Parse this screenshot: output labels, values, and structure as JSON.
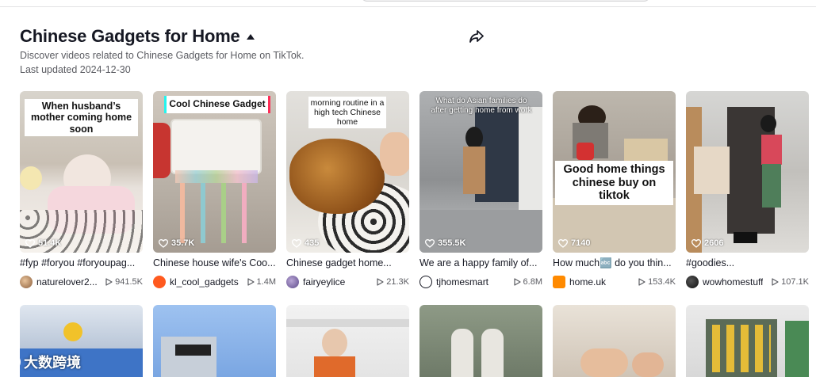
{
  "header": {
    "title": "Chinese Gadgets for Home",
    "description": "Discover videos related to Chinese Gadgets for Home on TikTok.",
    "last_updated": "Last updated 2024-12-30"
  },
  "videos": [
    {
      "overlay": "When husband’s mother coming home soon",
      "views": "51.4K",
      "caption": "#fyp #foryou #foryoupag...",
      "author": "naturelover2...",
      "plays": "941.5K"
    },
    {
      "overlay": "Cool Chinese Gadget",
      "views": "35.7K",
      "caption": "Chinese house wife's Coo...",
      "author": "kl_cool_gadgets",
      "plays": "1.4M"
    },
    {
      "overlay": "morning routine in a high tech Chinese home",
      "views": "435",
      "caption": "Chinese gadget home...",
      "author": "fairyeylice",
      "plays": "21.3K"
    },
    {
      "overlay": "What do Asian families do after getting home from work",
      "views": "355.5K",
      "caption": "We are a happy family of...",
      "author": "tjhomesmart",
      "plays": "6.8M"
    },
    {
      "overlay": "Good home things chinese buy on tiktok",
      "views": "7140",
      "caption": "How much🔤 do you thin...",
      "author": "home.uk",
      "plays": "153.4K"
    },
    {
      "overlay": "",
      "views": "2606",
      "caption": "#goodies...",
      "author": "wowhomestuff",
      "plays": "107.1K"
    }
  ],
  "watermark": "大数跨境",
  "colors": {
    "text": "#161823",
    "muted": "#5b5c62",
    "accent": "#fe2c55"
  }
}
